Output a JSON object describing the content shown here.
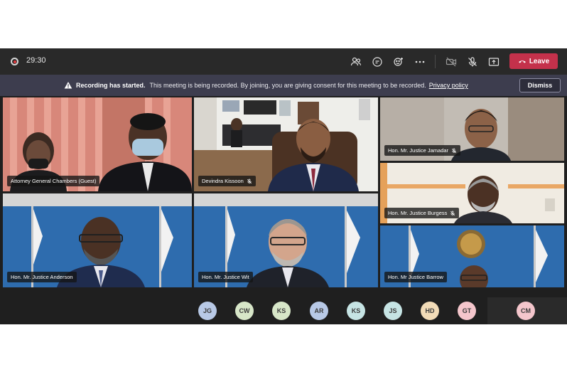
{
  "meeting": {
    "timer": "29:30",
    "leave_label": "Leave"
  },
  "banner": {
    "title": "Recording has started.",
    "message": "This meeting is being recorded. By joining, you are giving consent for this meeting to be recorded.",
    "link": "Privacy policy",
    "dismiss_label": "Dismiss"
  },
  "participants": [
    {
      "name": "Attorney General Chambers (Guest)",
      "muted": false
    },
    {
      "name": "Devindra Kissoon",
      "muted": true
    },
    {
      "name": "Hon. Mr. Justice Jamadar",
      "muted": true
    },
    {
      "name": "Hon. Mr. Justice Burgess",
      "muted": true
    },
    {
      "name": "Hon. Mr. Justice Anderson",
      "muted": false
    },
    {
      "name": "Hon. Mr. Justice Wit",
      "muted": false
    },
    {
      "name": "Hon. Mr Justice Barrow",
      "muted": false
    }
  ],
  "avatars": [
    {
      "initials": "JG",
      "color": "#b8c9e6"
    },
    {
      "initials": "CW",
      "color": "#d7e6c8"
    },
    {
      "initials": "KS",
      "color": "#d7e6c8"
    },
    {
      "initials": "AR",
      "color": "#b8c9e6"
    },
    {
      "initials": "KS",
      "color": "#c6e4e4"
    },
    {
      "initials": "JS",
      "color": "#c6e4e4"
    },
    {
      "initials": "HD",
      "color": "#f2dcb8"
    },
    {
      "initials": "GT",
      "color": "#f4c6cc"
    },
    {
      "initials": "CM",
      "color": "#f4c6cc"
    }
  ],
  "colors": {
    "leave": "#c4314b",
    "banner": "#3d3d4e",
    "topbar": "#292929"
  }
}
